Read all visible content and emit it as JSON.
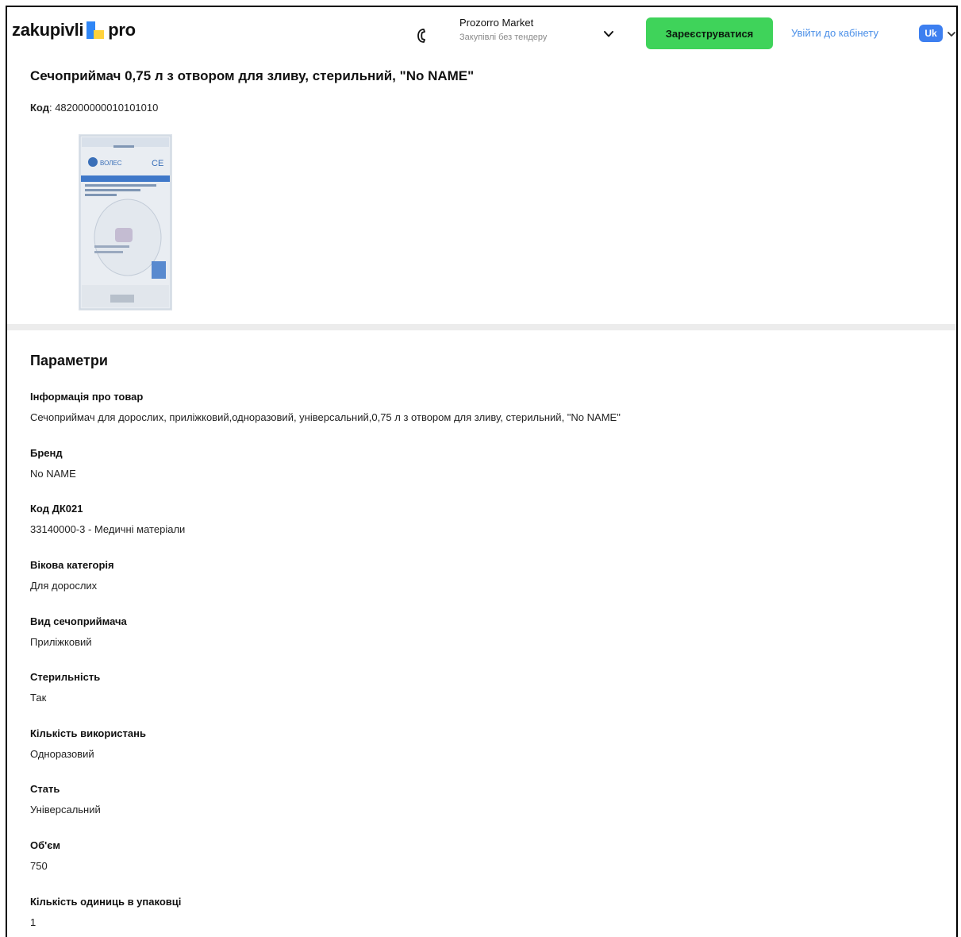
{
  "header": {
    "logo": {
      "left": "zakupivli",
      "right": "pro"
    },
    "market_title": "Prozorro Market",
    "market_subtitle": "Закупівлі без тендеру",
    "register_label": "Зареєструватися",
    "login_label": "Увійти до кабінету",
    "language": "Uk"
  },
  "product": {
    "title": "Сечоприймач 0,75 л з отвором для зливу, стерильний, \"No NAME\"",
    "code_label": "Код",
    "code_value": "482000000010101010",
    "image_text": {
      "brand": "ВОЛЕС",
      "mark": "CE"
    }
  },
  "params": {
    "title": "Параметри",
    "items": [
      {
        "label": "Інформація про товар",
        "value": "Сечоприймач для дорослих, приліжковий,одноразовий, універсальний,0,75 л з отвором для зливу, стерильний, \"No NAME\""
      },
      {
        "label": "Бренд",
        "value": "No NAME"
      },
      {
        "label": "Код ДК021",
        "value": "33140000-3 - Медичні матеріали"
      },
      {
        "label": "Вікова категорія",
        "value": "Для дорослих"
      },
      {
        "label": "Вид сечоприймача",
        "value": "Приліжковий"
      },
      {
        "label": "Стерильність",
        "value": "Так"
      },
      {
        "label": "Кількість використань",
        "value": "Одноразовий"
      },
      {
        "label": "Стать",
        "value": "Універсальний"
      },
      {
        "label": "Об'єм",
        "value": "750"
      },
      {
        "label": "Кількість одиниць в упаковці",
        "value": "1"
      }
    ]
  },
  "colors": {
    "accent_green": "#3fd35a",
    "link_blue": "#4a8fe8",
    "logo_blue": "#2f86f6",
    "logo_yellow": "#ffd23c"
  },
  "icons": [
    "phone-icon",
    "chevron-down-icon"
  ]
}
